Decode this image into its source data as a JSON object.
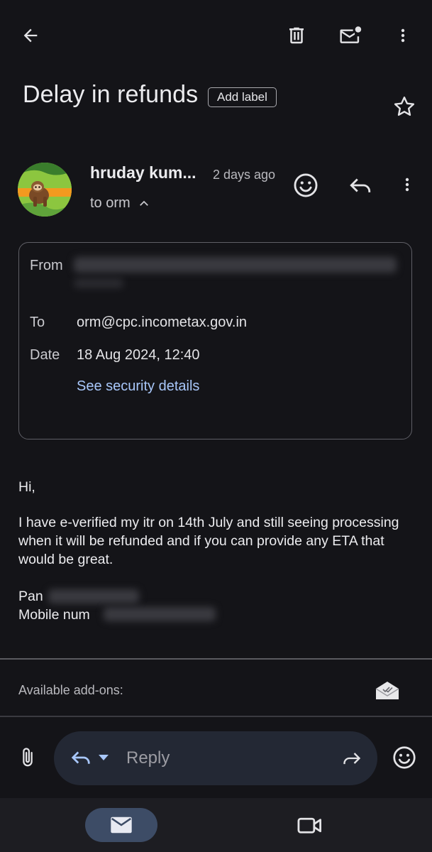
{
  "toolbar": {
    "back_icon": "arrow-left-icon",
    "delete_icon": "trash-icon",
    "mark_unread_icon": "mail-unread-icon",
    "more_icon": "more-vert-icon"
  },
  "email": {
    "subject": "Delay in refunds",
    "add_label": "Add label",
    "sender_name": "hruday kum...",
    "time_ago": "2 days ago",
    "recipient_line": "to orm"
  },
  "details": {
    "from_label": "From",
    "to_label": "To",
    "to_value": "orm@cpc.incometax.gov.in",
    "date_label": "Date",
    "date_value": "18 Aug 2024, 12:40",
    "security_link": "See security details"
  },
  "message": {
    "greeting": "Hi,",
    "paragraph": "I have e-verified my itr on 14th July and still seeing processing when it will be refunded and if you can provide any ETA that would be great.",
    "pan_prefix": "Pan",
    "mobile_prefix": "Mobile num"
  },
  "addons": {
    "label": "Available add-ons:"
  },
  "reply_bar": {
    "placeholder": "Reply"
  },
  "colors": {
    "background": "#141418",
    "link": "#a8c7fa",
    "reply_pill": "#232834",
    "nav_active": "#3d4c66"
  }
}
